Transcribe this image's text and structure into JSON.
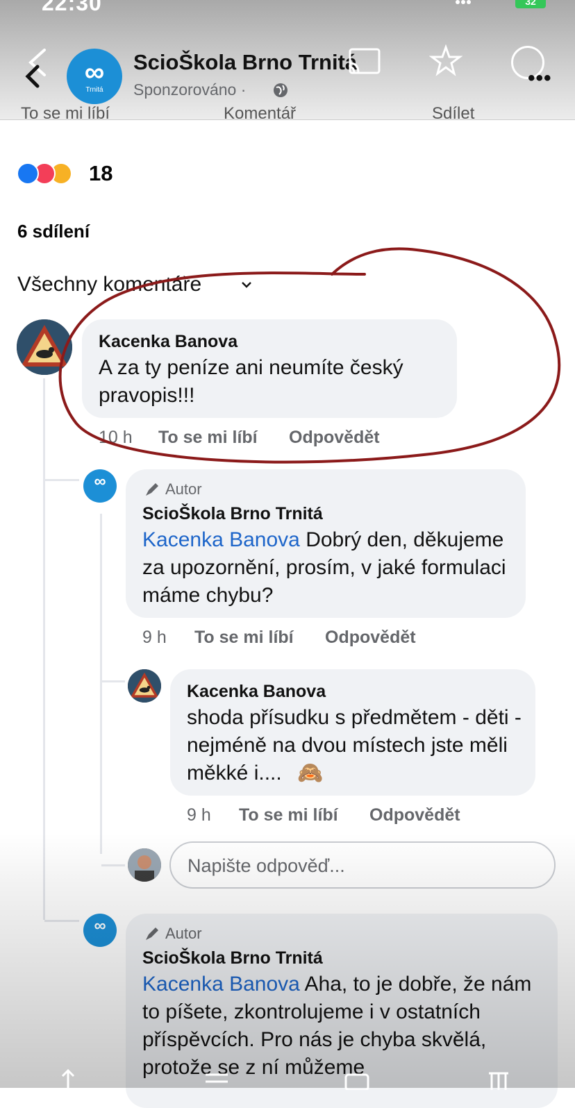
{
  "status_bar": {
    "time": "22:30",
    "battery": "32"
  },
  "header": {
    "page_name": "ScioŠkola Brno Trnitá",
    "sponsored": "Sponzorováno ·",
    "avatar_sub": "Trnitá"
  },
  "post_actions": {
    "like": "To se mi líbí",
    "comment": "Komentář",
    "share": "Sdílet"
  },
  "reactions": {
    "count": "18",
    "icons": [
      "like-icon",
      "love-icon",
      "haha-icon"
    ]
  },
  "shares": "6 sdílení",
  "comments_filter": "Všechny komentáře",
  "comments": [
    {
      "author": "Kacenka Banova",
      "text": "A za ty peníze ani neumíte český pravopis!!!",
      "time": "10 h",
      "like": "To se mi líbí",
      "reply": "Odpovědět"
    },
    {
      "badge": "Autor",
      "author": "ScioŠkola Brno Trnitá",
      "mention": "Kacenka Banova",
      "text": "Dobrý den, děkujeme za upozornění, prosím, v jaké formulaci máme chybu?",
      "time": "9 h",
      "like": "To se mi líbí",
      "reply": "Odpovědět"
    },
    {
      "author": "Kacenka Banova",
      "text": "shoda přísudku s předmětem - děti - nejméně na dvou místech jste měli měkké i....",
      "emoji": "🙈",
      "time": "9 h",
      "like": "To se mi líbí",
      "reply": "Odpovědět"
    },
    {
      "badge": "Autor",
      "author": "ScioŠkola Brno Trnitá",
      "mention": "Kacenka Banova",
      "text": "Aha, to je dobře, že nám to píšete, zkontrolujeme i v ostatních příspěvcích. Pro nás je chyba skvělá, protože se z ní můžeme"
    }
  ],
  "reply_input": {
    "placeholder": "Napište odpověď..."
  },
  "colors": {
    "accent": "#1c8fd6",
    "mention": "#1d65c9",
    "annotation": "#8b1a1a",
    "bubble": "#f0f2f5"
  }
}
